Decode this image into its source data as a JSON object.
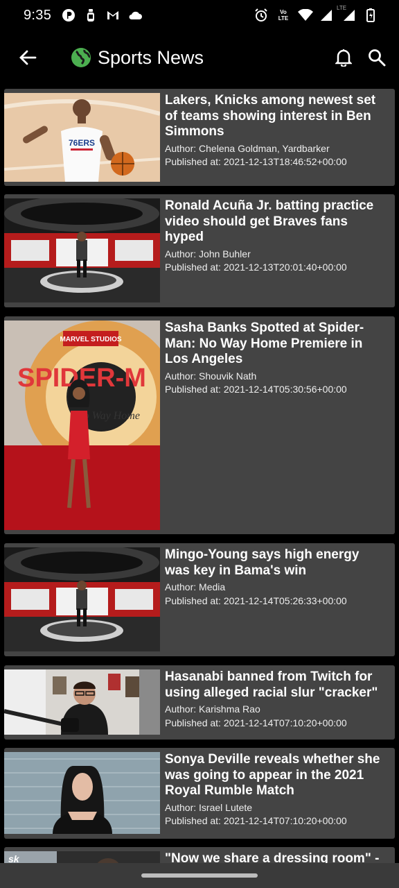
{
  "status_bar": {
    "time": "9:35",
    "left_icons": [
      "pinterest-icon",
      "bottle-icon",
      "gmail-icon",
      "cloud-icon"
    ],
    "right_icons": [
      "alarm-icon",
      "volte-icon",
      "wifi-icon",
      "signal-icon",
      "lte-signal-icon",
      "battery-icon"
    ],
    "volte_label": "Vo LTE",
    "lte_label": "LTE"
  },
  "app_bar": {
    "title": "Sports News",
    "accent_color": "#4caf50"
  },
  "articles": [
    {
      "title": "Lakers, Knicks among newest set of teams showing interest in Ben Simmons",
      "author": "Author: Chelena Goldman, Yardbarker",
      "published": "Published at: 2021-12-13T18:46:52+00:00",
      "jersey_text": "76ERS"
    },
    {
      "title": "Ronald Acuña Jr. batting practice video should get Braves fans hyped",
      "author": "Author: John Buhler",
      "published": "Published at: 2021-12-13T20:01:40+00:00"
    },
    {
      "title": "Sasha Banks Spotted at Spider-Man: No Way Home Premiere in Los Angeles",
      "author": "Author: Shouvik Nath",
      "published": "Published at: 2021-12-14T05:30:56+00:00",
      "poster_brand": "MARVEL STUDIOS",
      "poster_title": "SPIDER-M",
      "poster_sub": "No Way Home"
    },
    {
      "title": "Mingo-Young says high energy was key in Bama's win",
      "author": "Author: Media",
      "published": "Published at: 2021-12-14T05:26:33+00:00"
    },
    {
      "title": "Hasanabi banned from Twitch for using alleged racial slur \"cracker\"",
      "author": "Author: Karishma Rao",
      "published": "Published at: 2021-12-14T07:10:20+00:00"
    },
    {
      "title": "Sonya Deville reveals whether she was going to appear in the 2021 Royal Rumble Match",
      "author": "Author: Israel Lutete",
      "published": "Published at: 2021-12-14T07:10:20+00:00"
    },
    {
      "title": "\"Now we share a dressing room\" -",
      "thumb_text": "sk"
    }
  ]
}
